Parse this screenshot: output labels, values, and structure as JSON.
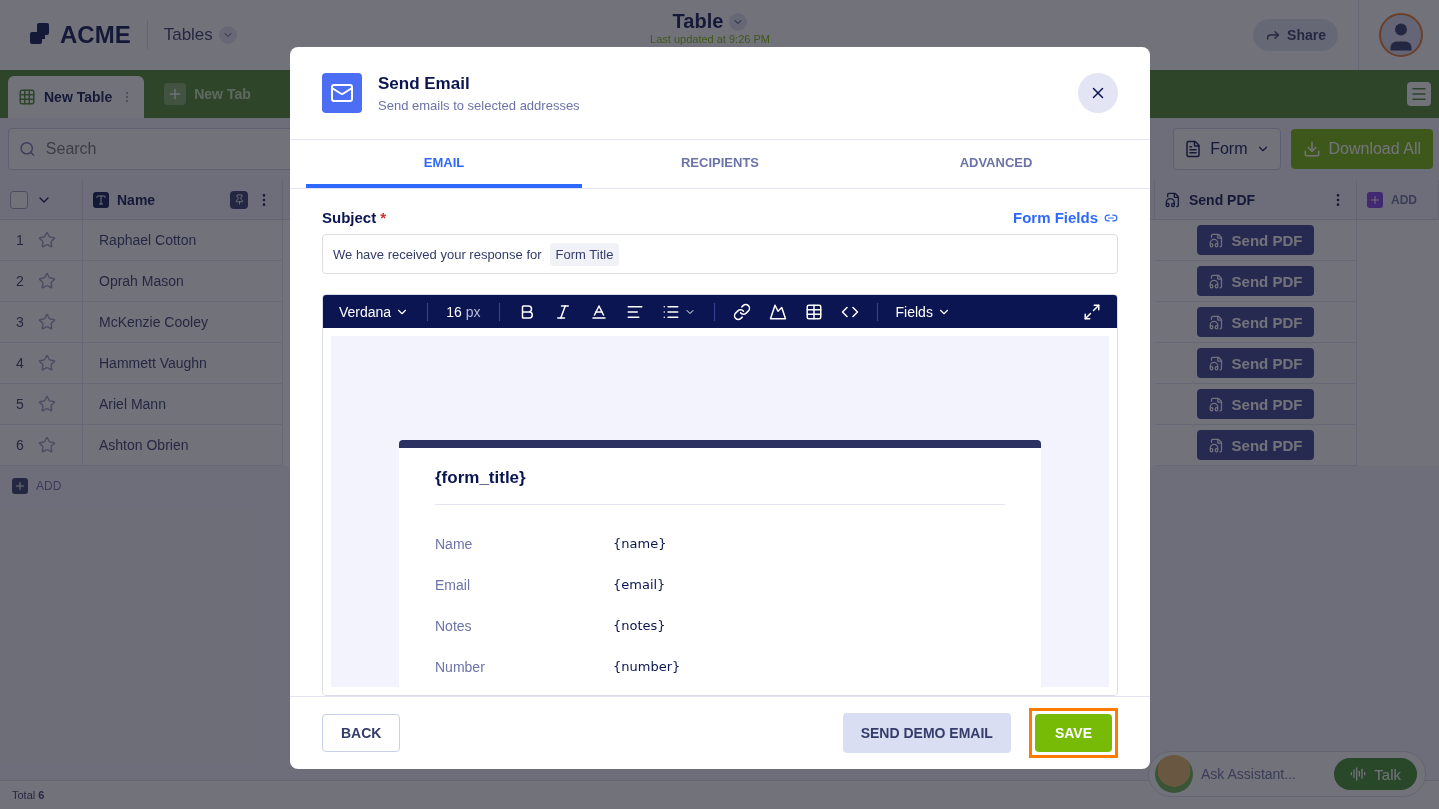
{
  "header": {
    "logo": "ACME",
    "app_menu": "Tables",
    "title": "Table",
    "last_updated": "Last updated at 9:26 PM",
    "share": "Share"
  },
  "tabs": [
    {
      "label": "New Table",
      "selected": true
    },
    {
      "label": "New Tab",
      "selected": false
    }
  ],
  "toolbar": {
    "search_placeholder": "Search",
    "form": "Form",
    "download": "Download All"
  },
  "table": {
    "select_all_checked": false,
    "columns": [
      {
        "label": "Name"
      },
      {
        "label": "Send PDF"
      }
    ],
    "add_column": "ADD",
    "rows": [
      {
        "index": "1",
        "name": "Raphael Cotton",
        "starred": false,
        "action": "Send PDF"
      },
      {
        "index": "2",
        "name": "Oprah Mason",
        "starred": false,
        "action": "Send PDF"
      },
      {
        "index": "3",
        "name": "McKenzie Cooley",
        "starred": false,
        "action": "Send PDF"
      },
      {
        "index": "4",
        "name": "Hammett Vaughn",
        "starred": false,
        "action": "Send PDF"
      },
      {
        "index": "5",
        "name": "Ariel Mann",
        "starred": false,
        "action": "Send PDF"
      },
      {
        "index": "6",
        "name": "Ashton Obrien",
        "starred": false,
        "action": "Send PDF"
      }
    ],
    "add_row": "ADD"
  },
  "status_bar": {
    "total": "Total **6**"
  },
  "assistant": {
    "placeholder": "Ask Assistant...",
    "talk": "Talk"
  },
  "dialog": {
    "title": "Send Email",
    "subtitle": "Send emails to selected addresses",
    "tabs": [
      {
        "label": "EMAIL",
        "selected": true
      },
      {
        "label": "RECIPIENTS",
        "selected": false
      },
      {
        "label": "ADVANCED",
        "selected": false
      }
    ],
    "subject_label": "Subject",
    "required_mark": "*",
    "form_fields_link": "Form Fields",
    "subject_text": "We have received your response for",
    "subject_tag": "Form Title",
    "editor": {
      "font": "Verdana",
      "size": "16",
      "size_unit": "px",
      "fields": "Fields"
    },
    "preview": {
      "title": "{form_title}",
      "rows": [
        {
          "label": "Name",
          "value": "{name}"
        },
        {
          "label": "Email",
          "value": "{email}"
        },
        {
          "label": "Notes",
          "value": "{notes}"
        },
        {
          "label": "Number",
          "value": "{number}"
        }
      ]
    },
    "buttons": {
      "back": "BACK",
      "demo": "SEND DEMO EMAIL",
      "save": "SAVE",
      "save_highlighted": true
    }
  }
}
